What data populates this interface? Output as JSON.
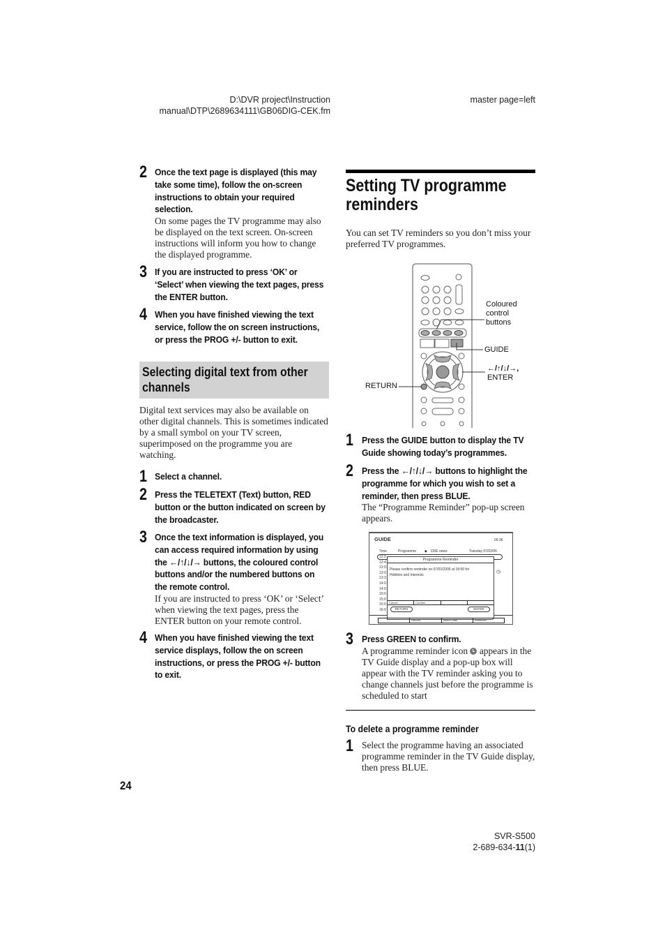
{
  "header": {
    "file_path_line1": "D:\\DVR project\\Instruction",
    "file_path_line2": "manual\\DTP\\2689634111\\GB06DIG-CEK.fm",
    "master_page": "master page=left"
  },
  "left_column": {
    "steps_top": [
      {
        "num": "2",
        "bold": "Once the text page is displayed (this may take some time), follow the on-screen instructions to obtain your required selection.",
        "body": "On some pages the TV programme may also be displayed on the text screen. On-screen instructions will inform you how to change the displayed programme."
      },
      {
        "num": "3",
        "bold": "If you are instructed to press ‘OK’ or ‘Select’ when viewing the text pages, press the ENTER button.",
        "body": ""
      },
      {
        "num": "4",
        "bold": "When you have finished viewing the text service, follow the on screen instructions, or press the PROG +/- button to exit.",
        "body": ""
      }
    ],
    "section_title": "Selecting digital text from other channels",
    "section_intro": "Digital text services may also be available on other digital channels. This is sometimes indicated by a small symbol on your TV screen, superimposed on the programme you are watching.",
    "steps": [
      {
        "num": "1",
        "bold": "Select a channel.",
        "body": ""
      },
      {
        "num": "2",
        "bold": "Press the TELETEXT (Text) button, RED button or the button indicated on screen by the broadcaster.",
        "body": ""
      },
      {
        "num": "3",
        "bold": "Once the text information is displayed, you can access required information by using the ←/↑/↓/→ buttons, the coloured control buttons and/or the numbered buttons on the remote control.",
        "body": "If you are instructed to press ‘OK’ or ‘Select’ when viewing the text pages, press the ENTER button on your remote control."
      },
      {
        "num": "4",
        "bold": "When you have finished viewing the text service displays, follow the on screen instructions, or press the PROG +/- button to exit.",
        "body": ""
      }
    ]
  },
  "right_column": {
    "title": "Setting TV programme reminders",
    "intro": "You can set TV reminders so you don’t miss your preferred TV programmes.",
    "remote_callouts": {
      "coloured": "Coloured control buttons",
      "guide": "GUIDE",
      "arrows": "←/↑/↓/→,",
      "enter": "ENTER",
      "return": "RETURN"
    },
    "steps": [
      {
        "num": "1",
        "bold": "Press the GUIDE button to display the TV Guide showing today’s programmes.",
        "body": ""
      },
      {
        "num": "2",
        "bold": "Press the ←/↑/↓/→ buttons to highlight the programme for which you wish to set a reminder, then press BLUE.",
        "body": "The “Programme Reminder” pop-up screen appears."
      },
      {
        "num": "3",
        "bold": "Press GREEN to confirm.",
        "body_pre": "A programme reminder icon",
        "body_post": "appears in the TV Guide display and a pop-up box will appear with the TV reminder asking you to change channels just before the programme is scheduled to start"
      }
    ],
    "guide_screen": {
      "title": "GUIDE",
      "clock": "09:36",
      "col_time": "Time",
      "col_programme": "Programme",
      "channel": "DDE news",
      "date": "Tuesday 07/02/06",
      "times": [
        "12:0",
        "12:4",
        "13:0",
        "13:0",
        "13:3",
        "14:0",
        "14:0",
        "15:0",
        "15:0",
        "15:0",
        "16:0"
      ],
      "popup_title": "Programme Reminder",
      "popup_message": "Please confirm reminder on 07/02/2006 at 18:00 for",
      "popup_programme": "Hobbies and Interests",
      "popup_options": [
        "Cancel",
        "Confirm",
        "",
        ""
      ],
      "popup_return": "RETURN",
      "popup_enter": "ENTER",
      "bottom_options": [
        "",
        "Record",
        "Select Date",
        "Reminder"
      ]
    },
    "delete_heading": "To delete a programme reminder",
    "delete_steps": [
      {
        "num": "1",
        "text": "Select the programme having an associated programme reminder in the TV Guide display, then press BLUE."
      }
    ]
  },
  "footer": {
    "page_number": "24",
    "model": "SVR-S500",
    "code_prefix": "2-689-634-",
    "code_bold": "11",
    "code_suffix": "(1)"
  }
}
